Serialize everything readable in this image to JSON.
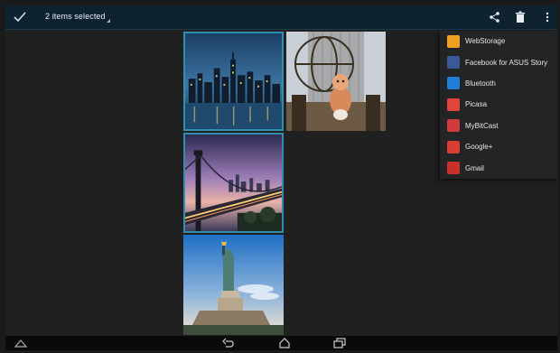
{
  "action_bar": {
    "selection_text": "2 items selected",
    "done_icon": "checkmark-icon",
    "actions": [
      {
        "name": "share",
        "icon": "share-icon"
      },
      {
        "name": "delete",
        "icon": "trash-icon"
      },
      {
        "name": "more",
        "icon": "overflow-menu-icon"
      }
    ]
  },
  "colors": {
    "action_bar": "#0f2230",
    "selection_border": "#2f8fb0",
    "menu_background": "#222426",
    "background": "#202020"
  },
  "gallery": {
    "photos": [
      {
        "subject": "night-skyline",
        "selected": true
      },
      {
        "subject": "atlas-statue-with-plush-toy",
        "selected": false
      },
      {
        "subject": "bridge-at-dusk",
        "selected": true
      },
      {
        "subject": "statue-of-liberty",
        "selected": false
      }
    ]
  },
  "share_menu": {
    "items": [
      {
        "label": "WebStorage",
        "icon": "webstorage-icon",
        "color": "#f0a020"
      },
      {
        "label": "Facebook for ASUS Story",
        "icon": "facebook-asus-story-icon",
        "color": "#3b5998"
      },
      {
        "label": "Bluetooth",
        "icon": "bluetooth-icon",
        "color": "#1e7fd8"
      },
      {
        "label": "Picasa",
        "icon": "picasa-icon",
        "color": "#e0453a"
      },
      {
        "label": "MyBitCast",
        "icon": "mybitcast-icon",
        "color": "#d23b3b"
      },
      {
        "label": "Google+",
        "icon": "google-plus-icon",
        "color": "#d73d32"
      },
      {
        "label": "Gmail",
        "icon": "gmail-icon",
        "color": "#c9302c"
      }
    ]
  },
  "nav_bar": {
    "buttons": [
      {
        "name": "notifications",
        "icon": "notification-up-icon"
      },
      {
        "name": "back",
        "icon": "back-icon"
      },
      {
        "name": "home",
        "icon": "home-icon"
      },
      {
        "name": "recent-apps",
        "icon": "recent-apps-icon"
      }
    ]
  }
}
